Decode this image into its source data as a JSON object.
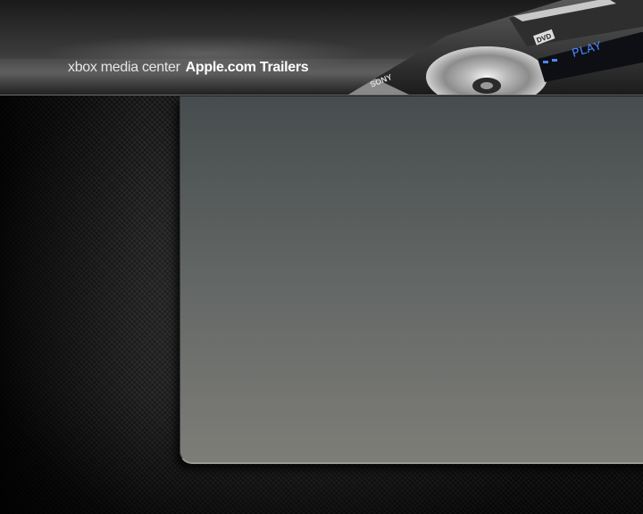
{
  "header": {
    "app_name": "xbox media center",
    "section_title": "Apple.com Trailers",
    "artwork": {
      "brand_text": "SONY",
      "tray_label": "DVD",
      "display_text": "PLAY",
      "display_color": "#3f7fff",
      "icon": "dvd-player-icon"
    }
  },
  "main_panel": {
    "state": "empty"
  },
  "colors": {
    "background": "#101010",
    "header_text": "#f0f0f0",
    "panel_top": "#474c4e",
    "panel_bottom": "#7d7d78"
  }
}
